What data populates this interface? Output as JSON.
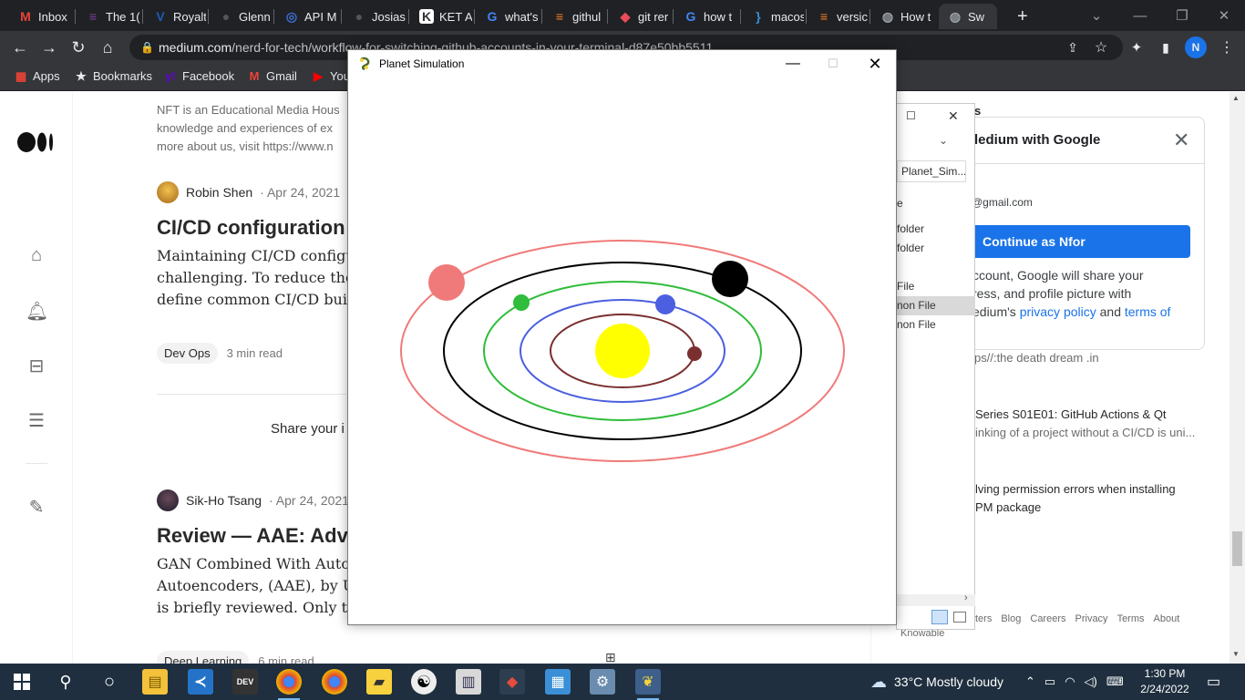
{
  "browser": {
    "tabs": [
      {
        "label": "Inbox",
        "icon": "gmail-icon",
        "color": "#ea4335",
        "glyph": "M"
      },
      {
        "label": "The 1(",
        "icon": "site-icon",
        "color": "#7b3fa0",
        "glyph": "≡"
      },
      {
        "label": "Royalt",
        "icon": "v-icon",
        "color": "#1e5bb8",
        "glyph": "V"
      },
      {
        "label": "Glenn",
        "icon": "github-icon",
        "color": "#555",
        "glyph": "●"
      },
      {
        "label": "API M",
        "icon": "api-icon",
        "color": "#3b6fd6",
        "glyph": "◎"
      },
      {
        "label": "Josias",
        "icon": "github-icon",
        "color": "#555",
        "glyph": "●"
      },
      {
        "label": "KET A",
        "icon": "ket-icon",
        "color": "#ffffff",
        "glyph": "K"
      },
      {
        "label": "what's",
        "icon": "google-icon",
        "color": "#4285f4",
        "glyph": "G"
      },
      {
        "label": "githul",
        "icon": "stackoverflow-icon",
        "color": "#f48024",
        "glyph": "≡"
      },
      {
        "label": "git rer",
        "icon": "gitkraken-icon",
        "color": "#e84c5a",
        "glyph": "◆"
      },
      {
        "label": "how t",
        "icon": "google-icon",
        "color": "#4285f4",
        "glyph": "G"
      },
      {
        "label": "macos",
        "icon": "brackets-icon",
        "color": "#3b8fd6",
        "glyph": "}"
      },
      {
        "label": "versic",
        "icon": "stackoverflow-icon",
        "color": "#f48024",
        "glyph": "≡"
      },
      {
        "label": "How t",
        "icon": "globe-icon",
        "color": "#9aa0a6",
        "glyph": "◍"
      },
      {
        "label": "Sw",
        "icon": "globe-icon",
        "color": "#9aa0a6",
        "glyph": "◍"
      }
    ],
    "new_tab": "+",
    "url_host": "medium.com",
    "url_path": "/nerd-for-tech/workflow-for-switching-github-accounts-in-your-terminal-d87e50bb5511",
    "profile_initial": "N",
    "bookmarks": [
      {
        "label": "Apps",
        "icon": "apps-grid-icon",
        "color": "#ea4335"
      },
      {
        "label": "Bookmarks",
        "icon": "star-icon",
        "color": "#e8eaed"
      },
      {
        "label": "Facebook",
        "icon": "yahoo-icon",
        "color": "#6001d2"
      },
      {
        "label": "Gmail",
        "icon": "gmail-icon",
        "color": "#ea4335"
      },
      {
        "label": "You",
        "icon": "youtube-icon",
        "color": "#ff0000"
      }
    ]
  },
  "medium": {
    "intro_lines": [
      "NFT is an Educational Media Hous",
      "knowledge and experiences of ex",
      "more about us, visit https://www.n"
    ],
    "article1": {
      "author": "Robin Shen",
      "date": "· Apr 24, 2021",
      "headline": "CI/CD configuration f",
      "lines": [
        "Maintaining CI/CD configurati",
        "challenging. To reduce the ove",
        "define common CI/CD buildin"
      ],
      "tag": "Dev Ops",
      "read_time": "3 min read"
    },
    "share_prompt": "Share your i",
    "article2": {
      "author": "Sik-Ho Tsang",
      "date": "· Apr 24, 2021",
      "headline": "Review — AAE: Adve",
      "lines": [
        "GAN Combined With Autoenco",
        "Autoencoders, (AAE), by Unive",
        "is briefly reviewed. Only the A"
      ],
      "tag": "Deep Learning",
      "read_time": "6 min read"
    },
    "right": {
      "header_fragment": "s",
      "link1": "ps//:the death dream .in",
      "item2_title": "Series S01E01: GitHub Actions & Qt",
      "item2_sub": "inking of a project without a CI/CD is uni...",
      "item3_title": "lving permission errors when installing",
      "item3_sub": "PM package",
      "footer": [
        "ters",
        "Blog",
        "Careers",
        "Privacy",
        "Terms",
        "About"
      ],
      "footer2": "Knowable"
    }
  },
  "google_popup": {
    "title": "ledium with Google",
    "email": "@gmail.com",
    "button": "Continue as Nfor",
    "body_lines": [
      "ccount, Google will share your",
      "ress, and profile picture with",
      "edium's "
    ],
    "privacy_link": "privacy policy",
    "and": " and ",
    "terms_link": "terms of"
  },
  "explorer": {
    "search_placeholder": "Planet_Sim...",
    "items": [
      "e",
      "folder",
      "folder",
      "",
      "File",
      "non File",
      "non File"
    ]
  },
  "sim_window": {
    "title": "Planet Simulation",
    "colors": {
      "sun": "#ffff00",
      "orbit1": "#7a2f2f",
      "orbit2": "#4b5fe0",
      "orbit3": "#2fbd3b",
      "orbit4": "#000000",
      "orbit5": "#f07a7a"
    }
  },
  "taskbar": {
    "weather": "33°C  Mostly cloudy",
    "time": "1:30 PM",
    "date": "2/24/2022"
  }
}
